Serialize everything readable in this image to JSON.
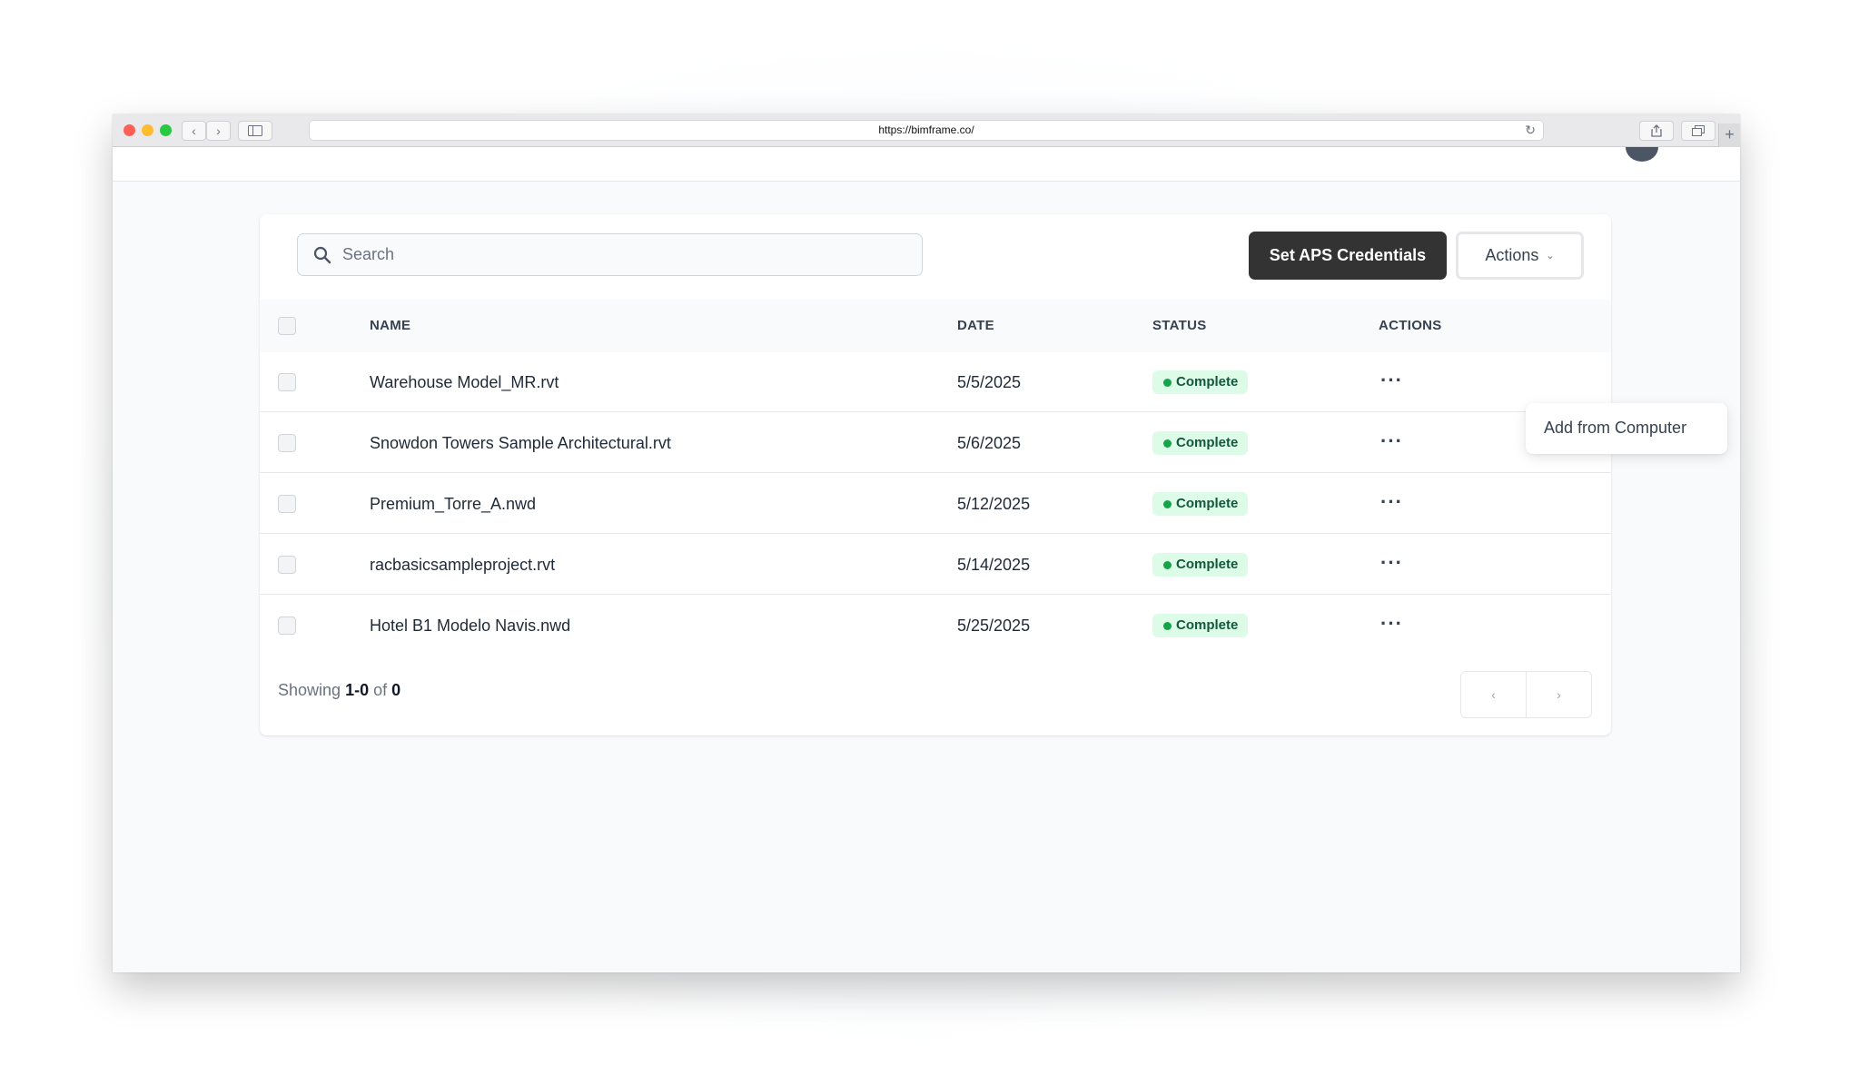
{
  "browser": {
    "url": "https://bimframe.co/",
    "back_glyph": "‹",
    "forward_glyph": "›"
  },
  "toolbar": {
    "search_placeholder": "Search",
    "credentials_label": "Set APS Credentials",
    "actions_label": "Actions",
    "actions_chevron": "⌄"
  },
  "table": {
    "headers": {
      "name": "NAME",
      "date": "DATE",
      "status": "STATUS",
      "actions": "ACTIONS"
    },
    "rows": [
      {
        "name": "Warehouse Model_MR.rvt",
        "date": "5/5/2025",
        "status": "Complete"
      },
      {
        "name": "Snowdon Towers Sample Architectural.rvt",
        "date": "5/6/2025",
        "status": "Complete"
      },
      {
        "name": "Premium_Torre_A.nwd",
        "date": "5/12/2025",
        "status": "Complete"
      },
      {
        "name": "racbasicsampleproject.rvt",
        "date": "5/14/2025",
        "status": "Complete"
      },
      {
        "name": "Hotel B1 Modelo Navis.nwd",
        "date": "5/25/2025",
        "status": "Complete"
      }
    ],
    "row_menu_glyph": "···"
  },
  "footer": {
    "showing_label": "Showing",
    "range": "1-0",
    "of_label": "of",
    "total": "0",
    "prev_glyph": "‹",
    "next_glyph": "›"
  },
  "dropdown": {
    "items": [
      "Add from Computer"
    ]
  },
  "colors": {
    "primary_button": "#333333",
    "status_badge_bg": "#dcfce7",
    "status_dot": "#16a34a"
  }
}
